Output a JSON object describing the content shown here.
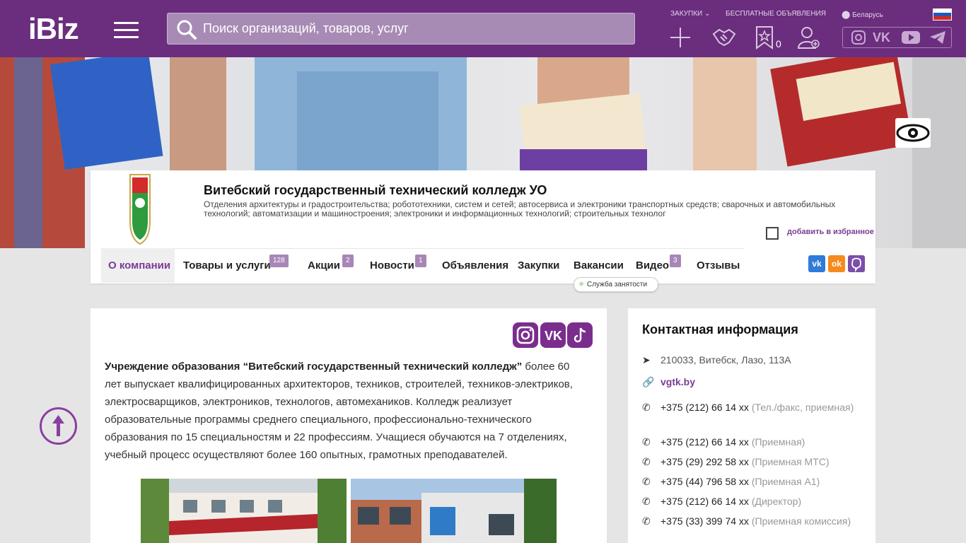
{
  "header": {
    "logo": "iBiz",
    "search_placeholder": "Поиск организаций, товаров, услуг",
    "links": {
      "purchases": "ЗАКУПКИ",
      "free_ads": "БЕСПЛАТНЫЕ ОБЪЯВЛЕНИЯ",
      "region": "Беларусь"
    },
    "favorites_count": "0"
  },
  "company": {
    "name": "Витебский государственный технический колледж УО",
    "description": "Отделения архитектуры и градостроительства; робототехники, систем и сетей; автосервиса и электроники транспортных средств; сварочных и автомобильных технологий; автоматизации и машиностроения; электроники и информационных технологий; строительных технолог",
    "add_favorite": "добавить в избранное"
  },
  "tabs": [
    {
      "label": "О компании"
    },
    {
      "label": "Товары и услуги",
      "badge": "128"
    },
    {
      "label": "Акции",
      "badge": "2"
    },
    {
      "label": "Новости",
      "badge": "1"
    },
    {
      "label": "Объявления"
    },
    {
      "label": "Закупки"
    },
    {
      "label": "Вакансии"
    },
    {
      "label": "Видео",
      "badge": "3"
    },
    {
      "label": "Отзывы"
    }
  ],
  "jobs_tooltip": "Служба занятости",
  "about": {
    "bold": "Учреждение образования “Витебский государственный технический колледж”",
    "text": " более 60 лет выпускает квалифицированных архитекторов, техников, строителей, техников-электриков, электросварщиков, электроников, технологов, автомехаников. Колледж реализует образовательные программы среднего специального, профессионально-технического образования по 15 специальностям и 22 профессиям. Учащиеся обучаются на 7 отделениях, учебный процесс осуществляют более 160 опытных, грамотных преподавателей."
  },
  "contacts": {
    "title": "Контактная информация",
    "address": "210033, Витебск, Лазо, 113А",
    "website": "vgtk.by",
    "phones": [
      {
        "number": "+375 (212) 66 14 xx",
        "note": "(Тел./факс, приемная)"
      },
      {
        "number": "+375 (212) 66 14 xx",
        "note": "(Приемная)"
      },
      {
        "number": "+375 (29) 292 58 xx",
        "note": "(Приемная МТС)"
      },
      {
        "number": "+375 (44) 796 58 xx",
        "note": "(Приемная А1)"
      },
      {
        "number": "+375 (212) 66 14 xx",
        "note": "(Директор)"
      },
      {
        "number": "+375 (33) 399 74 xx",
        "note": "(Приемная комиссия)"
      }
    ]
  },
  "colors": {
    "brand": "#6b2d7e",
    "accent": "#7b3b94",
    "badge": "#a887b7"
  }
}
